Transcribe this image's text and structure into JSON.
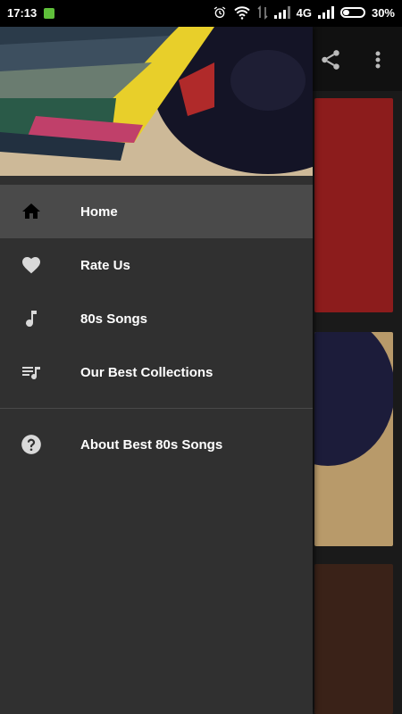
{
  "status": {
    "time": "17:13",
    "network": "4G",
    "battery": "30%",
    "battery_level": 0.3
  },
  "drawer": {
    "items": [
      {
        "label": "Home",
        "icon": "home-icon",
        "active": true
      },
      {
        "label": "Rate Us",
        "icon": "heart-icon"
      },
      {
        "label": "80s Songs",
        "icon": "music-note-icon"
      },
      {
        "label": "Our Best Collections",
        "icon": "playlist-icon"
      }
    ],
    "secondary": [
      {
        "label": "About Best 80s Songs",
        "icon": "help-icon"
      }
    ]
  },
  "background_app": {
    "icons": [
      "share-icon",
      "more-vert-icon"
    ],
    "colors": {
      "card1": "#9a1f1f",
      "card2": "#c8a97a",
      "card3": "#4a2a1a"
    }
  },
  "colors": {
    "drawer_bg": "#303030",
    "active_bg": "#4a4a4a",
    "text": "#ffffff",
    "icon": "#d9d9d9"
  }
}
